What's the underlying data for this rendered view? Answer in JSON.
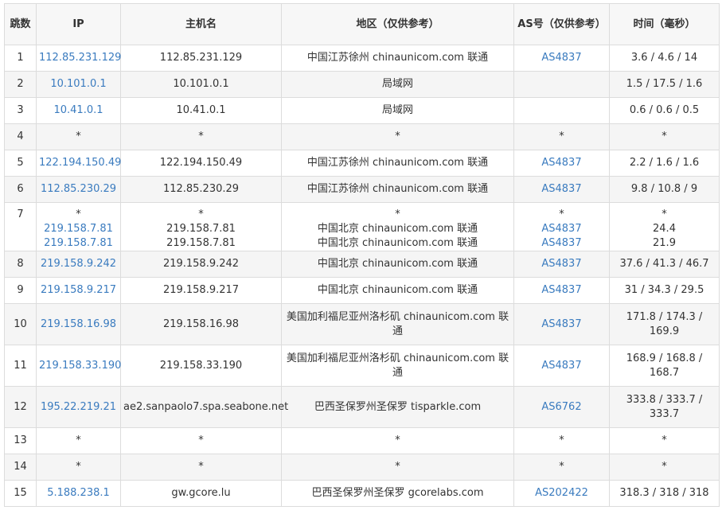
{
  "headers": {
    "hop": "跳数",
    "ip": "IP",
    "hostname": "主机名",
    "region": "地区（仅供参考）",
    "as": "AS号（仅供参考）",
    "time": "时间（毫秒）"
  },
  "rows": [
    {
      "hop": "1",
      "ip": [
        "112.85.231.129"
      ],
      "host": [
        "112.85.231.129"
      ],
      "region": [
        "中国江苏徐州 chinaunicom.com 联通"
      ],
      "as": [
        "AS4837"
      ],
      "time": [
        "3.6 / 4.6 / 14"
      ]
    },
    {
      "hop": "2",
      "ip": [
        "10.101.0.1"
      ],
      "host": [
        "10.101.0.1"
      ],
      "region": [
        "局域网"
      ],
      "as": [
        ""
      ],
      "time": [
        "1.5 / 17.5 / 1.6"
      ]
    },
    {
      "hop": "3",
      "ip": [
        "10.41.0.1"
      ],
      "host": [
        "10.41.0.1"
      ],
      "region": [
        "局域网"
      ],
      "as": [
        ""
      ],
      "time": [
        "0.6 / 0.6 / 0.5"
      ]
    },
    {
      "hop": "4",
      "ip": [
        "*"
      ],
      "host": [
        "*"
      ],
      "region": [
        "*"
      ],
      "as": [
        "*"
      ],
      "time": [
        "*"
      ]
    },
    {
      "hop": "5",
      "ip": [
        "122.194.150.49"
      ],
      "host": [
        "122.194.150.49"
      ],
      "region": [
        "中国江苏徐州 chinaunicom.com 联通"
      ],
      "as": [
        "AS4837"
      ],
      "time": [
        "2.2 / 1.6 / 1.6"
      ]
    },
    {
      "hop": "6",
      "ip": [
        "112.85.230.29"
      ],
      "host": [
        "112.85.230.29"
      ],
      "region": [
        "中国江苏徐州 chinaunicom.com 联通"
      ],
      "as": [
        "AS4837"
      ],
      "time": [
        "9.8 / 10.8 / 9"
      ]
    },
    {
      "hop": "7",
      "ip": [
        "*",
        "219.158.7.81",
        "219.158.7.81"
      ],
      "host": [
        "*",
        "219.158.7.81",
        "219.158.7.81"
      ],
      "region": [
        "*",
        "中国北京 chinaunicom.com 联通",
        "中国北京 chinaunicom.com 联通"
      ],
      "as": [
        "*",
        "AS4837",
        "AS4837"
      ],
      "time": [
        "*",
        "24.4",
        "21.9"
      ]
    },
    {
      "hop": "8",
      "ip": [
        "219.158.9.242"
      ],
      "host": [
        "219.158.9.242"
      ],
      "region": [
        "中国北京 chinaunicom.com 联通"
      ],
      "as": [
        "AS4837"
      ],
      "time": [
        "37.6 / 41.3 / 46.7"
      ]
    },
    {
      "hop": "9",
      "ip": [
        "219.158.9.217"
      ],
      "host": [
        "219.158.9.217"
      ],
      "region": [
        "中国北京 chinaunicom.com 联通"
      ],
      "as": [
        "AS4837"
      ],
      "time": [
        "31 / 34.3 / 29.5"
      ]
    },
    {
      "hop": "10",
      "ip": [
        "219.158.16.98"
      ],
      "host": [
        "219.158.16.98"
      ],
      "region": [
        "美国加利福尼亚州洛杉矶 chinaunicom.com 联通"
      ],
      "as": [
        "AS4837"
      ],
      "time": [
        "171.8 / 174.3 / 169.9"
      ]
    },
    {
      "hop": "11",
      "ip": [
        "219.158.33.190"
      ],
      "host": [
        "219.158.33.190"
      ],
      "region": [
        "美国加利福尼亚州洛杉矶 chinaunicom.com 联通"
      ],
      "as": [
        "AS4837"
      ],
      "time": [
        "168.9 / 168.8 / 168.7"
      ]
    },
    {
      "hop": "12",
      "ip": [
        "195.22.219.21"
      ],
      "host": [
        "ae2.sanpaolo7.spa.seabone.net"
      ],
      "region": [
        "巴西圣保罗州圣保罗 tisparkle.com"
      ],
      "as": [
        "AS6762"
      ],
      "time": [
        "333.8 / 333.7 / 333.7"
      ]
    },
    {
      "hop": "13",
      "ip": [
        "*"
      ],
      "host": [
        "*"
      ],
      "region": [
        "*"
      ],
      "as": [
        "*"
      ],
      "time": [
        "*"
      ]
    },
    {
      "hop": "14",
      "ip": [
        "*"
      ],
      "host": [
        "*"
      ],
      "region": [
        "*"
      ],
      "as": [
        "*"
      ],
      "time": [
        "*"
      ]
    },
    {
      "hop": "15",
      "ip": [
        "5.188.238.1"
      ],
      "host": [
        "gw.gcore.lu"
      ],
      "region": [
        "巴西圣保罗州圣保罗 gcorelabs.com"
      ],
      "as": [
        "AS202422"
      ],
      "time": [
        "318.3 / 318 / 318"
      ]
    }
  ]
}
